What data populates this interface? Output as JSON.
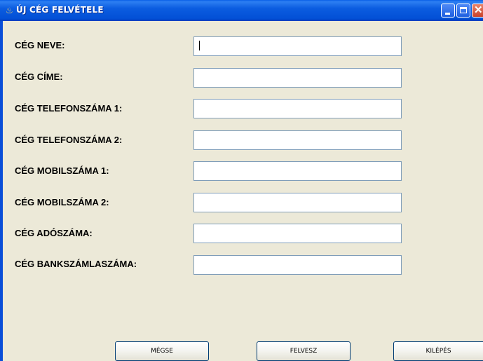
{
  "window": {
    "title": "ÚJ CÉG FELVÉTELE"
  },
  "form": {
    "fields": [
      {
        "label": "CÉG NEVE:",
        "value": ""
      },
      {
        "label": "CÉG CÍME:",
        "value": ""
      },
      {
        "label": "CÉG TELEFONSZÁMA 1:",
        "value": ""
      },
      {
        "label": "CÉG TELEFONSZÁMA 2:",
        "value": ""
      },
      {
        "label": "CÉG MOBILSZÁMA 1:",
        "value": ""
      },
      {
        "label": "CÉG MOBILSZÁMA 2:",
        "value": ""
      },
      {
        "label": "CÉG ADÓSZÁMA:",
        "value": ""
      },
      {
        "label": "CÉG BANKSZÁMLASZÁMA:",
        "value": ""
      }
    ]
  },
  "buttons": {
    "cancel": "MÉGSE",
    "add": "FELVESZ",
    "exit": "KILÉPÉS"
  },
  "icons": {
    "window_icon": "java-cup-icon",
    "minimize": "minimize-icon",
    "maximize": "maximize-icon",
    "close": "close-icon"
  }
}
